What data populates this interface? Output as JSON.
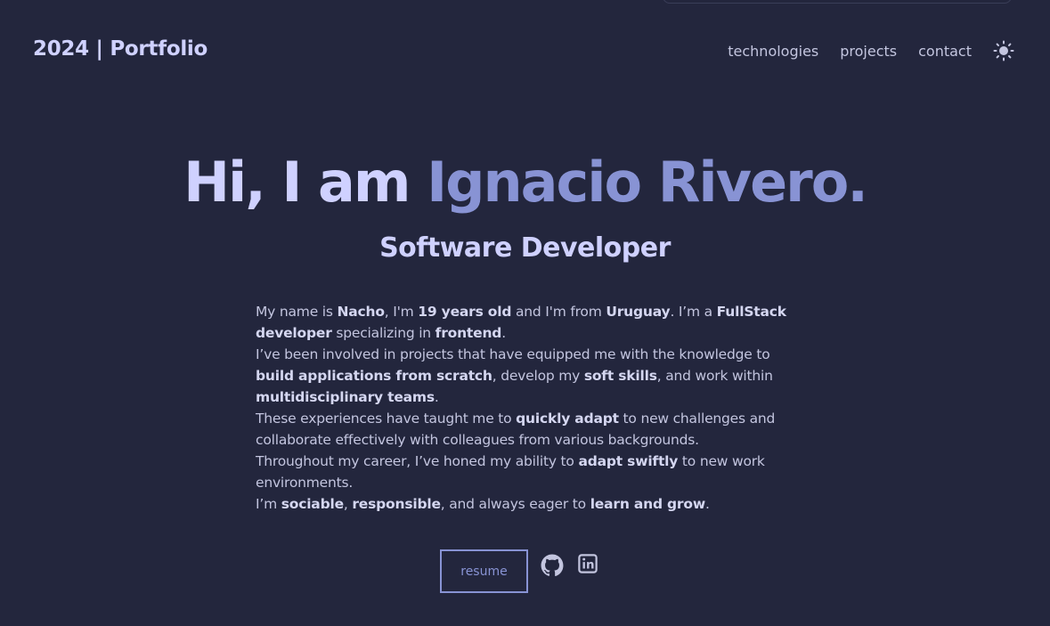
{
  "header": {
    "logo": "2024 | Portfolio",
    "nav": [
      "technologies",
      "projects",
      "contact"
    ],
    "theme_icon": "sun-icon"
  },
  "hero": {
    "greeting": "Hi, I am ",
    "name": "Ignacio Rivero.",
    "subtitle": "Software Developer"
  },
  "bio": {
    "l1": [
      "My name is ",
      "Nacho",
      ", I'm ",
      "19 years old",
      " and I'm from ",
      "Uruguay",
      ". I’m a ",
      "FullStack developer",
      " specializing in ",
      "frontend",
      "."
    ],
    "l2": [
      "I’ve been involved in projects that have equipped me with the knowledge to ",
      "build applications from scratch",
      ", develop my ",
      "soft skills",
      ", and work within ",
      "multidisciplinary teams",
      "."
    ],
    "l3": [
      "These experiences have taught me to ",
      "quickly adapt",
      " to new challenges and collaborate effectively with colleagues from various backgrounds."
    ],
    "l4": [
      "Throughout my career, I’ve honed my ability to ",
      "adapt swiftly",
      " to new work environments."
    ],
    "l5": [
      "I’m ",
      "sociable",
      ", ",
      "responsible",
      ", and always eager to ",
      "learn and grow",
      "."
    ]
  },
  "actions": {
    "resume": "resume",
    "github_icon": "github-icon",
    "linkedin_icon": "linkedin-icon"
  },
  "colors": {
    "background": "#23263d",
    "accent": "#8893d4",
    "heading": "#cfd1ff",
    "text": "#c3c5df"
  }
}
